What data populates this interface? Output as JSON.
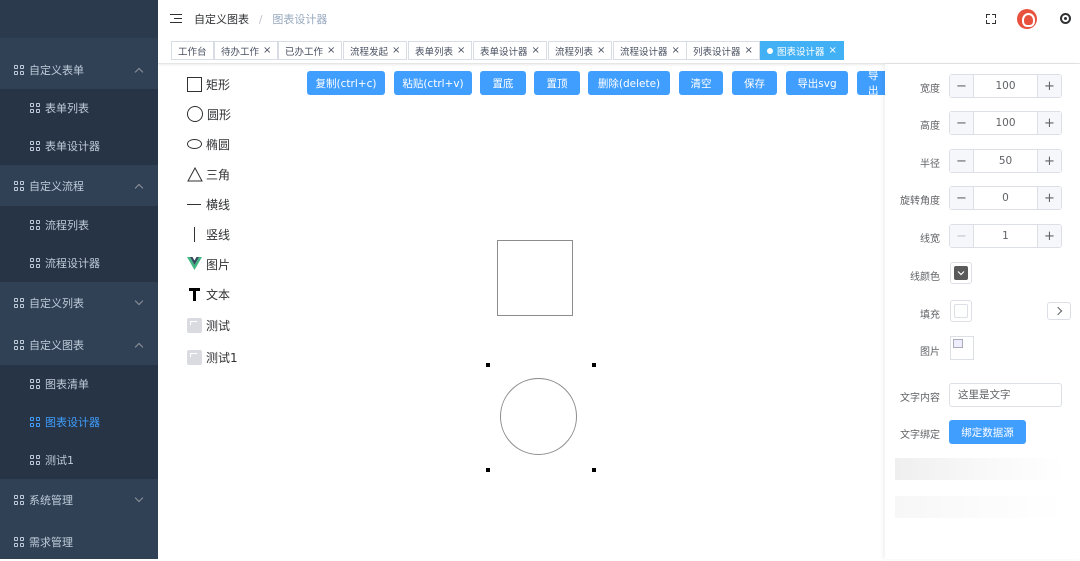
{
  "sidebar": {
    "items": [
      {
        "label": "自定义表单",
        "level": "parent",
        "expanded": true
      },
      {
        "label": "表单列表",
        "level": "child"
      },
      {
        "label": "表单设计器",
        "level": "child"
      },
      {
        "label": "自定义流程",
        "level": "parent",
        "expanded": true
      },
      {
        "label": "流程列表",
        "level": "child"
      },
      {
        "label": "流程设计器",
        "level": "child"
      },
      {
        "label": "自定义列表",
        "level": "parent",
        "expanded": false
      },
      {
        "label": "自定义图表",
        "level": "parent",
        "expanded": true
      },
      {
        "label": "图表清单",
        "level": "child"
      },
      {
        "label": "图表设计器",
        "level": "child",
        "active": true
      },
      {
        "label": "测试1",
        "level": "child"
      },
      {
        "label": "系统管理",
        "level": "parent",
        "expanded": false
      },
      {
        "label": "需求管理",
        "level": "parent"
      }
    ]
  },
  "breadcrumb": {
    "parent": "自定义图表",
    "separator": "/",
    "current": "图表设计器"
  },
  "tags": [
    {
      "label": "工作台",
      "closable": false
    },
    {
      "label": "待办工作",
      "closable": true
    },
    {
      "label": "已办工作",
      "closable": true
    },
    {
      "label": "流程发起",
      "closable": true
    },
    {
      "label": "表单列表",
      "closable": true
    },
    {
      "label": "表单设计器",
      "closable": true
    },
    {
      "label": "流程列表",
      "closable": true
    },
    {
      "label": "流程设计器",
      "closable": true
    },
    {
      "label": "列表设计器",
      "closable": true
    },
    {
      "label": "图表设计器",
      "closable": true,
      "active": true
    }
  ],
  "palette": [
    {
      "label": "矩形",
      "icon": "rectangle-icon"
    },
    {
      "label": "圆形",
      "icon": "circle-icon"
    },
    {
      "label": "椭圆",
      "icon": "ellipse-icon"
    },
    {
      "label": "三角",
      "icon": "triangle-icon"
    },
    {
      "label": "横线",
      "icon": "horizontal-line-icon"
    },
    {
      "label": "竖线",
      "icon": "vertical-line-icon"
    },
    {
      "label": "图片",
      "icon": "vue-logo-icon"
    },
    {
      "label": "文本",
      "icon": "text-t-icon"
    },
    {
      "label": "测试",
      "icon": "image-thumbnail-icon"
    },
    {
      "label": "测试1",
      "icon": "image-thumbnail-icon"
    }
  ],
  "toolbar": {
    "copy": "复制(ctrl+c)",
    "paste": "粘贴(ctrl+v)",
    "bottom": "置底",
    "top": "置顶",
    "delete": "删除(delete)",
    "clear": "清空",
    "save": "保存",
    "export_svg": "导出svg",
    "export_more": "导出"
  },
  "properties": {
    "width": {
      "label": "宽度",
      "value": "100"
    },
    "height": {
      "label": "高度",
      "value": "100"
    },
    "radius": {
      "label": "半径",
      "value": "50"
    },
    "rotation": {
      "label": "旋转角度",
      "value": "0"
    },
    "line_width": {
      "label": "线宽",
      "value": "1"
    },
    "line_color": {
      "label": "线颜色",
      "color": "#606266"
    },
    "fill": {
      "label": "填充",
      "color": "#ffffff"
    },
    "image": {
      "label": "图片"
    },
    "text_content": {
      "label": "文字内容",
      "value": "这里是文字"
    },
    "text_binding": {
      "label": "文字绑定",
      "button": "绑定数据源"
    },
    "minus": "−",
    "plus": "+"
  },
  "colors": {
    "accent": "#409eff",
    "sidebar_bg": "#304156",
    "active_tag": "#42b0f5"
  }
}
